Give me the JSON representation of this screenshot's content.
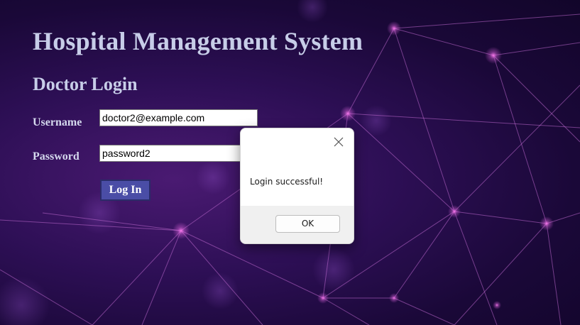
{
  "app": {
    "title": "Hospital Management System",
    "subtitle": "Doctor Login"
  },
  "form": {
    "username_label": "Username",
    "username_value": "doctor2@example.com",
    "password_label": "Password",
    "password_value": "password2",
    "login_button": "Log In"
  },
  "dialog": {
    "message": "Login successful!",
    "ok_button": "OK",
    "close_icon": "close-icon"
  },
  "colors": {
    "heading_text": "#c7cde8",
    "login_button_bg": "#4a4da6",
    "network_lines": "#c06ad0",
    "background_dark": "#1a0838"
  }
}
